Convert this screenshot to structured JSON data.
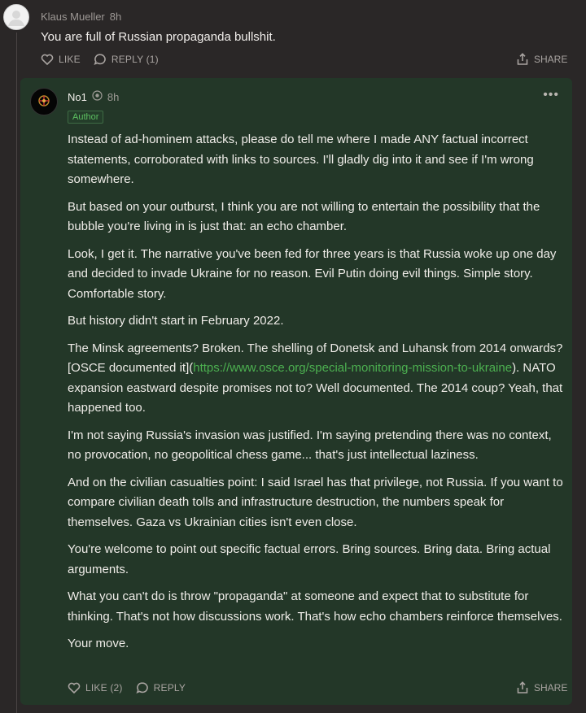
{
  "top_comment": {
    "author": "Klaus Mueller",
    "time": "8h",
    "text": "You are full of Russian propaganda bullshit.",
    "like_label": "LIKE",
    "reply_label": "REPLY (1)",
    "share_label": "SHARE"
  },
  "reply": {
    "author": "No1",
    "time": "8h",
    "badge": "Author",
    "more_label": "•••",
    "paragraphs": [
      "Instead of ad-hominem attacks, please do tell me where I made ANY factual incorrect statements, corroborated with links to sources. I'll gladly dig into it and see if I'm wrong somewhere.",
      "But based on your outburst, I think you are not willing to entertain the possibility that the bubble you're living in is just that: an echo chamber.",
      "Look, I get it. The narrative you've been fed for three years is that Russia woke up one day and decided to invade Ukraine for no reason. Evil Putin doing evil things. Simple story. Comfortable story.",
      "But history didn't start in February 2022."
    ],
    "minsk_pre": "The Minsk agreements? Broken. The shelling of Donetsk and Luhansk from 2014 onwards? [OSCE documented it](",
    "minsk_link": "https://www.osce.org/special-monitoring-mission-to-ukraine",
    "minsk_post": "). NATO expansion eastward despite promises not to? Well documented. The 2014 coup? Yeah, that happened too.",
    "paragraphs_after": [
      "I'm not saying Russia's invasion was justified. I'm saying pretending there was no context, no provocation, no geopolitical chess game... that's just intellectual laziness.",
      "And on the civilian casualties point: I said Israel has that privilege, not Russia. If you want to compare civilian death tolls and infrastructure destruction, the numbers speak for themselves. Gaza vs Ukrainian cities isn't even close.",
      "You're welcome to point out specific factual errors. Bring sources. Bring data. Bring actual arguments.",
      "What you can't do is throw \"propaganda\" at someone and expect that to substitute for thinking. That's not how discussions work. That's how echo chambers reinforce themselves.",
      "Your move."
    ],
    "like_label": "LIKE (2)",
    "reply_label": "REPLY",
    "share_label": "SHARE"
  },
  "colors": {
    "background": "#2a2727",
    "card": "#233728",
    "link": "#4cb050",
    "author_badge": "#5cc061"
  }
}
